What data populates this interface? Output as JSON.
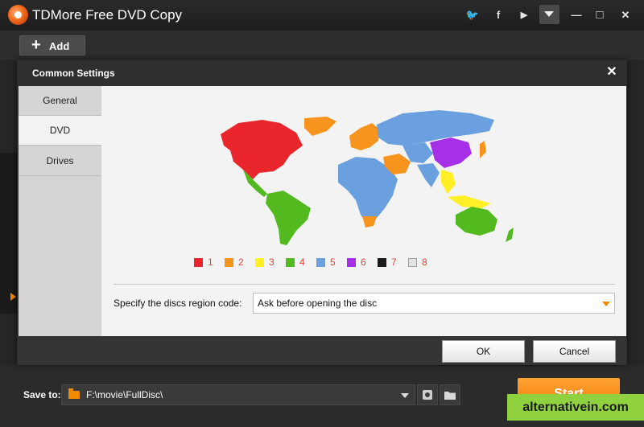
{
  "window": {
    "title": "TDMore Free DVD Copy"
  },
  "titlebar": {
    "icons": [
      "twitter-icon",
      "facebook-icon",
      "youtube-icon",
      "dropdown-icon",
      "minimize-icon",
      "maximize-icon",
      "close-icon"
    ],
    "twitter_glyph": "🐦",
    "facebook_glyph": "f",
    "youtube_glyph": "▶",
    "minimize_glyph": "—",
    "maximize_glyph": "□",
    "close_glyph": "✕"
  },
  "toolbar": {
    "add_plus": "+",
    "add_label": "Add"
  },
  "dialog": {
    "title": "Common Settings",
    "close_glyph": "✕",
    "tabs": [
      {
        "label": "General",
        "active": false
      },
      {
        "label": "DVD",
        "active": true
      },
      {
        "label": "Drives",
        "active": false
      }
    ],
    "legend": [
      {
        "label": "1",
        "color": "#e8262b"
      },
      {
        "label": "2",
        "color": "#f7941e"
      },
      {
        "label": "3",
        "color": "#ffef24"
      },
      {
        "label": "4",
        "color": "#52b91f"
      },
      {
        "label": "5",
        "color": "#6aa0df"
      },
      {
        "label": "6",
        "color": "#a530e8"
      },
      {
        "label": "7",
        "color": "#1b1b1b"
      },
      {
        "label": "8",
        "color": "#e3e3e3"
      }
    ],
    "region_label": "Specify the discs region code:",
    "region_value": "Ask before opening the disc",
    "ok_label": "OK",
    "cancel_label": "Cancel"
  },
  "bottom": {
    "save_label": "Save to:",
    "save_path": "F:\\movie\\FullDisc\\",
    "start_label": "Start"
  },
  "watermark": "alternativein.com",
  "colors": {
    "accent": "#f08a00",
    "watermark": "#8fd13f"
  }
}
